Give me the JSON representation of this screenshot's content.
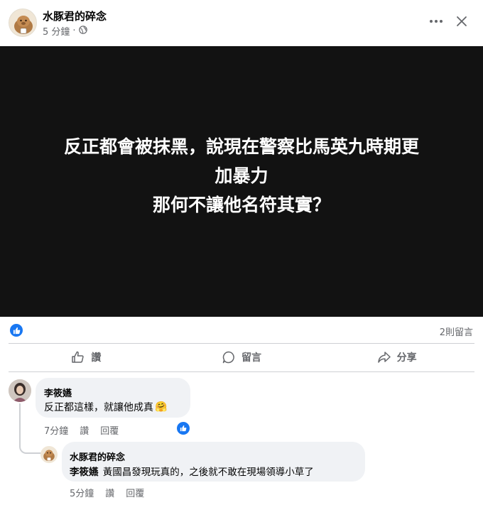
{
  "header": {
    "page_name": "水豚君的碎念",
    "time": "5 分鐘",
    "separator": "·",
    "privacy_icon": "globe-icon",
    "more_icon": "more-horizontal-icon",
    "close_icon": "close-icon"
  },
  "post": {
    "text_lines": [
      "反正都會被抹黑，說現在警察比馬英九時期更",
      "加暴力",
      "那何不讓他名符其實？"
    ]
  },
  "reactions": {
    "icon": "like-icon",
    "comment_count": "2則留言"
  },
  "actions": [
    {
      "label": "讚",
      "icon": "thumbs-up-icon"
    },
    {
      "label": "留言",
      "icon": "comment-icon"
    },
    {
      "label": "分享",
      "icon": "share-icon"
    }
  ],
  "comments": [
    {
      "author": "李筱嬿",
      "text": "反正都這樣，就讓他成真",
      "emoji": "🤗",
      "time": "7分鐘",
      "like_label": "讚",
      "reply_label": "回覆",
      "reaction_icon": "like-icon"
    }
  ],
  "replies": [
    {
      "author": "水豚君的碎念",
      "mention": "李筱嬿",
      "text": " 黃國昌發現玩真的，之後就不敢在現場領導小草了",
      "time": "5分鐘",
      "like_label": "讚",
      "reply_label": "回覆"
    }
  ],
  "colors": {
    "accent": "#1877f2",
    "secondary_text": "#65676b",
    "bubble": "#f0f2f5",
    "image_bg": "#121212"
  }
}
